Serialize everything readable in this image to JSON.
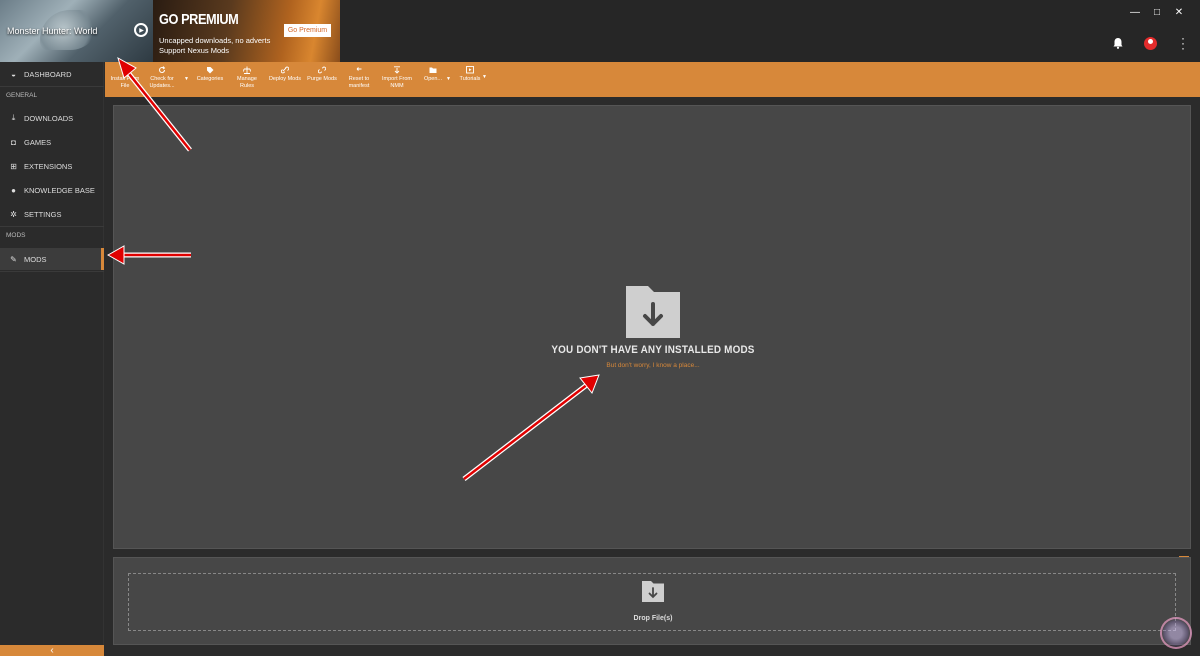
{
  "game": {
    "name": "Monster Hunter: World"
  },
  "premium": {
    "title": "GO PREMIUM",
    "line1": "Uncapped downloads, no adverts",
    "line2": "Support Nexus Mods",
    "button": "Go Premium"
  },
  "window_controls": {
    "minimize": "—",
    "maximize": "□",
    "close": "✕"
  },
  "sidebar": {
    "dashboard": "DASHBOARD",
    "general_header": "GENERAL",
    "downloads": "DOWNLOADS",
    "games": "GAMES",
    "extensions": "EXTENSIONS",
    "knowledge_base": "KNOWLEDGE BASE",
    "settings": "SETTINGS",
    "mods_header": "MODS",
    "mods": "MODS",
    "collapse": "‹"
  },
  "toolbar": {
    "install_l1": "Install From",
    "install_l2": "File",
    "check_l1": "Check for",
    "check_l2": "Updates...",
    "categories": "Categories",
    "manage_l1": "Manage",
    "manage_l2": "Rules",
    "deploy": "Deploy Mods",
    "purge": "Purge Mods",
    "reset_l1": "Reset to",
    "reset_l2": "manifest",
    "import_l1": "Import From",
    "import_l2": "NMM",
    "open": "Open...",
    "tutorials": "Tutorials"
  },
  "mods_panel": {
    "empty_title": "YOU DON'T HAVE ANY INSTALLED MODS",
    "empty_sub": "But don't worry, I know a place..."
  },
  "drop": {
    "label": "Drop File(s)"
  },
  "colors": {
    "accent": "#d7883a",
    "panel": "#474747",
    "background": "#2b2b2b",
    "arrow": "#e00000"
  }
}
